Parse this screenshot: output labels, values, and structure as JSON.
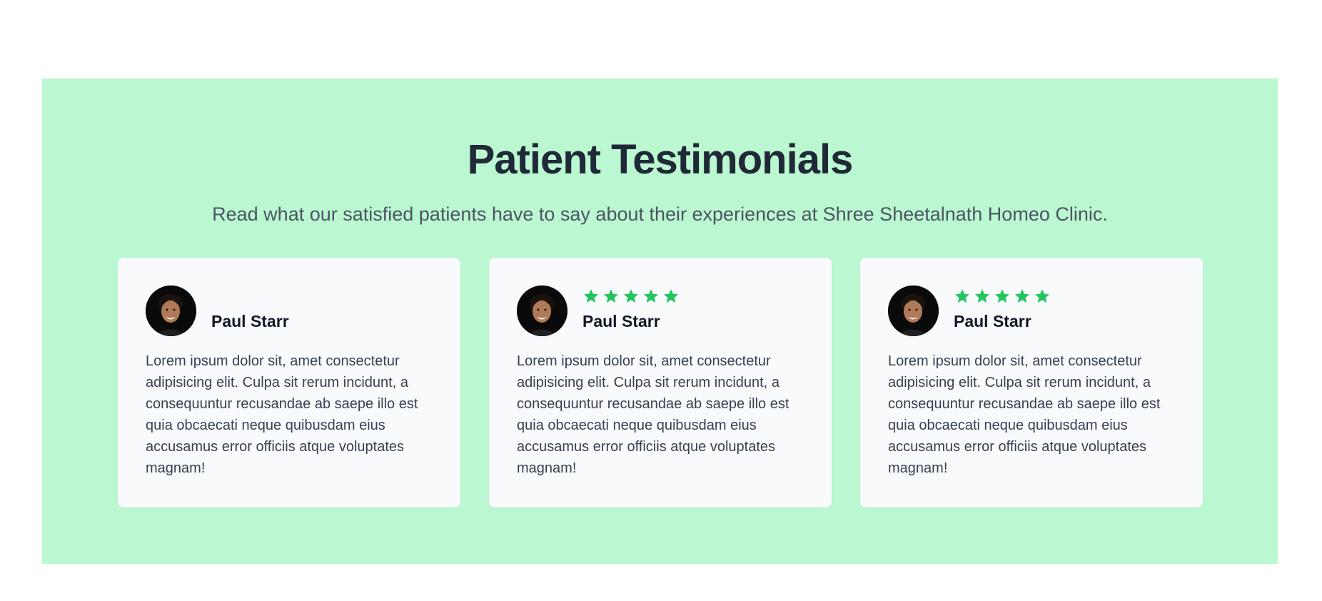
{
  "section": {
    "title": "Patient Testimonials",
    "subtitle": "Read what our satisfied patients have to say about their experiences at Shree Sheetalnath Homeo Clinic.",
    "background_color": "#bbf7d0"
  },
  "testimonials": [
    {
      "name": "Paul Starr",
      "rating": 0,
      "text": "Lorem ipsum dolor sit, amet consectetur adipisicing elit. Culpa sit rerum incidunt, a consequuntur recusandae ab saepe illo est quia obcaecati neque quibusdam eius accusamus error officiis atque voluptates magnam!",
      "avatar_icon": "person-portrait"
    },
    {
      "name": "Paul Starr",
      "rating": 5,
      "text": "Lorem ipsum dolor sit, amet consectetur adipisicing elit. Culpa sit rerum incidunt, a consequuntur recusandae ab saepe illo est quia obcaecati neque quibusdam eius accusamus error officiis atque voluptates magnam!",
      "avatar_icon": "person-portrait"
    },
    {
      "name": "Paul Starr",
      "rating": 5,
      "text": "Lorem ipsum dolor sit, amet consectetur adipisicing elit. Culpa sit rerum incidunt, a consequuntur recusandae ab saepe illo est quia obcaecati neque quibusdam eius accusamus error officiis atque voluptates magnam!",
      "avatar_icon": "person-portrait"
    }
  ],
  "star_color": "#22c55e",
  "star_icon": "star-icon"
}
